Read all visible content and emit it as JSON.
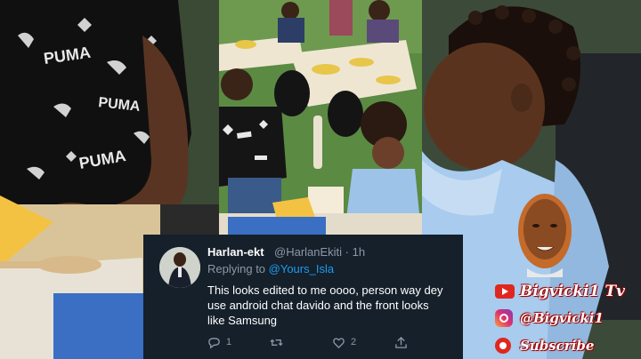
{
  "tweet": {
    "display_name": "Harlan-ekt",
    "handle_time": "@HarlanEkiti · 1h",
    "replying_prefix": "Replying to ",
    "replying_handle": "@Yours_Isla",
    "text": "This looks edited to me oooo, person way dey use android chat davido and the front looks like Samsung",
    "replies": "1",
    "retweets": "",
    "likes": "2"
  },
  "branding": {
    "channel_name": "Bigvicki1 Tv",
    "instagram_handle": "@Bigvicki1",
    "subscribe_label": "Subscribe"
  },
  "shirt_text": {
    "logo_a": "PUMA",
    "logo_b": "PUMA",
    "logo_c": "PUMA"
  },
  "colors": {
    "tweet_bg": "#15202b",
    "link_blue": "#1d9bf0",
    "muted_gray": "#8b98a5",
    "brand_red": "#e0271f"
  },
  "icons": [
    "reply-icon",
    "retweet-icon",
    "like-icon",
    "share-icon",
    "youtube-icon",
    "instagram-icon",
    "subscribe-icon"
  ]
}
